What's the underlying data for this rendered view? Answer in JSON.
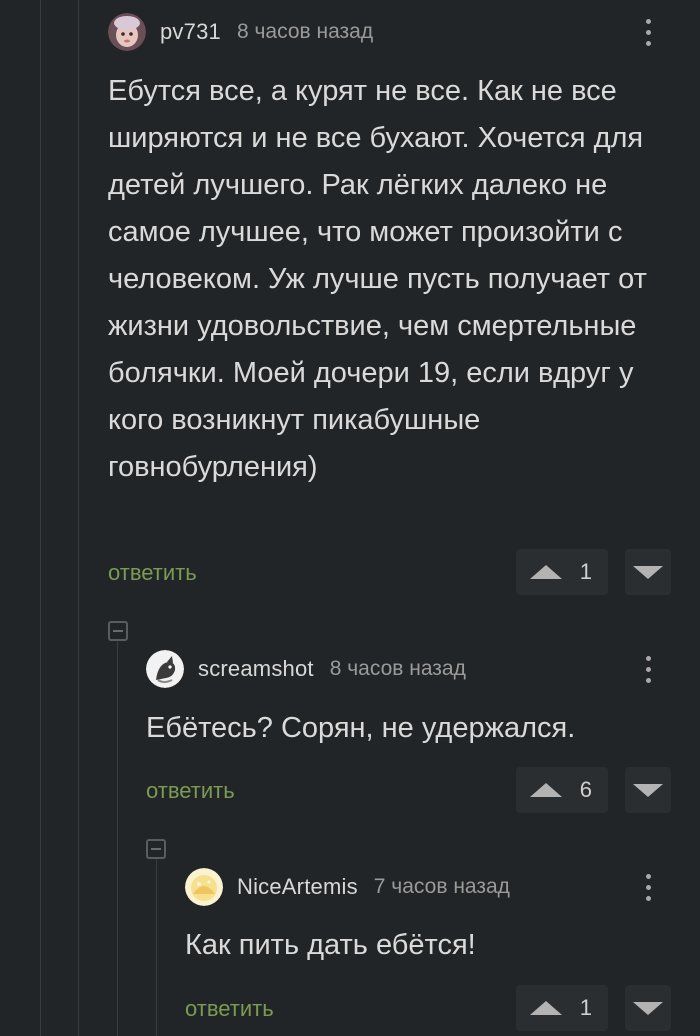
{
  "comments": [
    {
      "username": "pv731",
      "timestamp": "8 часов назад",
      "text": "Ебутся все, а курят не все. Как не все ширяются и не все бухают. Хочется для детей лучшего. Рак лёгких далеко не самое лучшее, что может произойти с человеком. Уж лучше пусть получает от жизни удовольствие, чем смертельные болячки. Моей дочери 19, если вдруг у кого возникнут пикабушные говнобурления)",
      "reply_label": "ответить",
      "rating": "1"
    },
    {
      "username": "screamshot",
      "timestamp": "8 часов назад",
      "text": "Ебётесь? Сорян, не удержался.",
      "reply_label": "ответить",
      "rating": "6"
    },
    {
      "username": "NiceArtemis",
      "timestamp": "7 часов назад",
      "text": "Как пить дать ебётся!",
      "reply_label": "ответить",
      "rating": "1"
    }
  ],
  "colors": {
    "background": "#222527",
    "reply_link": "#7b9a52",
    "vote_box": "#2b2e31",
    "thread_line": "#3a3d3f"
  },
  "icons": {
    "menu": "kebab-menu-icon",
    "vote_up": "triangle-up-icon",
    "vote_down": "triangle-down-icon",
    "collapse": "minus-square-icon"
  }
}
